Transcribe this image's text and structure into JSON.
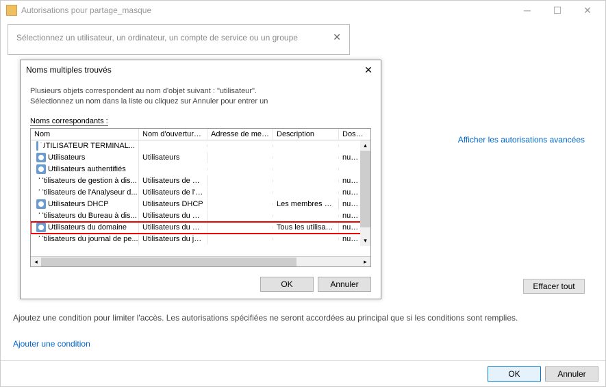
{
  "main": {
    "title": "Autorisations pour partage_masque",
    "selectUserPrompt": "Sélectionnez un utilisateur, un ordinateur, un compte de service ou un groupe",
    "advancedLink": "Afficher les autorisations avancées",
    "clearAllLabel": "Effacer tout",
    "conditionText": "Ajoutez une condition pour limiter l'accès. Les autorisations spécifiées ne seront accordées au principal que si les conditions sont remplies.",
    "addConditionLink": "Ajouter une condition",
    "okLabel": "OK",
    "cancelLabel": "Annuler"
  },
  "dialog": {
    "title": "Noms multiples trouvés",
    "notice1": "Plusieurs objets correspondent au nom d'objet suivant : \"utilisateur\".",
    "notice2": "Sélectionnez un nom dans la liste ou cliquez sur Annuler pour entrer un",
    "matchingLabel": "Noms correspondants :",
    "cols": {
      "nom": "Nom",
      "ouv": "Nom d'ouverture ...",
      "addr": "Adresse de mes...",
      "desc": "Description",
      "dos": "Dossier"
    },
    "rows": [
      {
        "nom": "UTILISATEUR TERMINAL...",
        "ouv": "",
        "addr": "",
        "desc": "",
        "dos": ""
      },
      {
        "nom": "Utilisateurs",
        "ouv": "Utilisateurs",
        "addr": "",
        "desc": "",
        "dos": "numelio"
      },
      {
        "nom": "Utilisateurs authentifiés",
        "ouv": "",
        "addr": "",
        "desc": "",
        "dos": ""
      },
      {
        "nom": "Utilisateurs de gestion à dis...",
        "ouv": "Utilisateurs de ge...",
        "addr": "",
        "desc": "",
        "dos": "numelio"
      },
      {
        "nom": "Utilisateurs de l'Analyseur d...",
        "ouv": "Utilisateurs de l'A...",
        "addr": "",
        "desc": "",
        "dos": "numelio"
      },
      {
        "nom": "Utilisateurs DHCP",
        "ouv": "Utilisateurs DHCP",
        "addr": "",
        "desc": "Les membres qui...",
        "dos": "numelio"
      },
      {
        "nom": "Utilisateurs du Bureau à dis...",
        "ouv": "Utilisateurs du B...",
        "addr": "",
        "desc": "",
        "dos": "numelio"
      },
      {
        "nom": "Utilisateurs du domaine",
        "ouv": "Utilisateurs du do...",
        "addr": "",
        "desc": "Tous les utilisate...",
        "dos": "numelio",
        "highlight": true
      },
      {
        "nom": "Utilisateurs du journal de pe...",
        "ouv": "Utilisateurs du jo...",
        "addr": "",
        "desc": "",
        "dos": "numelio"
      }
    ],
    "okLabel": "OK",
    "cancelLabel": "Annuler"
  }
}
